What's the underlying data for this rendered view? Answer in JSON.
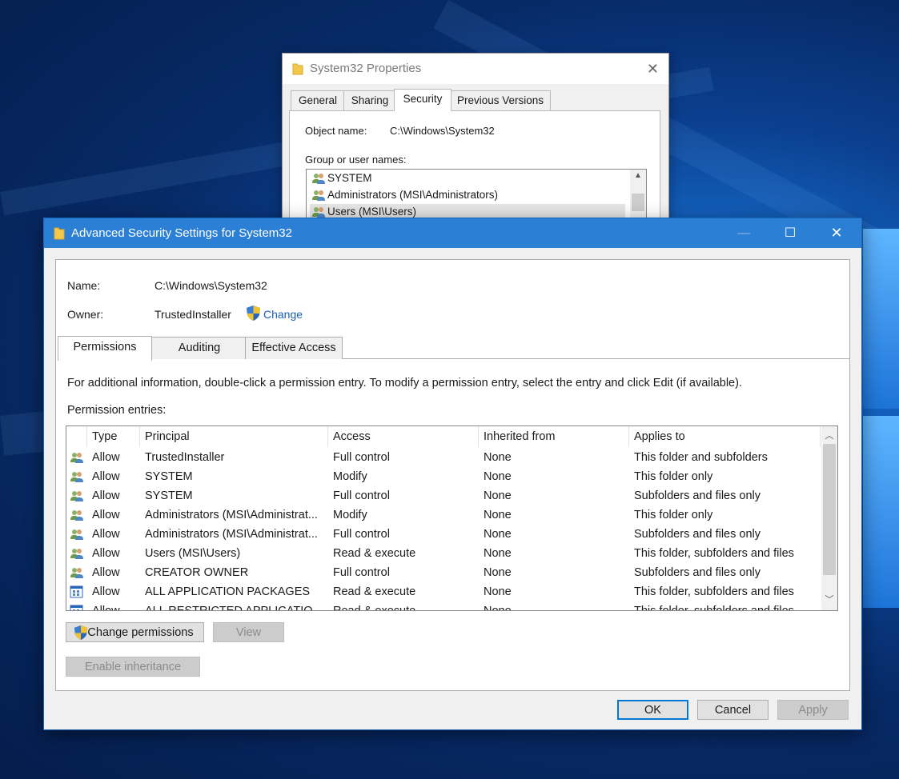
{
  "colors": {
    "accent": "#2b80d6",
    "link": "#1a5fb4"
  },
  "properties_window": {
    "title": "System32 Properties",
    "tabs": [
      {
        "label": "General"
      },
      {
        "label": "Sharing"
      },
      {
        "label": "Security"
      },
      {
        "label": "Previous Versions"
      }
    ],
    "active_tab": "Security",
    "object_name_label": "Object name:",
    "object_name_value": "C:\\Windows\\System32",
    "group_label": "Group or user names:",
    "groups": [
      {
        "name": "SYSTEM"
      },
      {
        "name": "Administrators (MSI\\Administrators)"
      },
      {
        "name": "Users (MSI\\Users)"
      }
    ]
  },
  "dialog": {
    "title": "Advanced Security Settings for System32",
    "name_label": "Name:",
    "name_value": "C:\\Windows\\System32",
    "owner_label": "Owner:",
    "owner_value": "TrustedInstaller",
    "change_link": "Change",
    "tabs": [
      {
        "label": "Permissions"
      },
      {
        "label": "Auditing"
      },
      {
        "label": "Effective Access"
      }
    ],
    "active_tab": "Permissions",
    "info_text": "For additional information, double-click a permission entry. To modify a permission entry, select the entry and click Edit (if available).",
    "entries_label": "Permission entries:",
    "columns": [
      "Type",
      "Principal",
      "Access",
      "Inherited from",
      "Applies to"
    ],
    "rows": [
      {
        "icon": "user-group-icon",
        "type": "Allow",
        "principal": "TrustedInstaller",
        "access": "Full control",
        "inherited": "None",
        "applies": "This folder and subfolders"
      },
      {
        "icon": "user-group-icon",
        "type": "Allow",
        "principal": "SYSTEM",
        "access": "Modify",
        "inherited": "None",
        "applies": "This folder only"
      },
      {
        "icon": "user-group-icon",
        "type": "Allow",
        "principal": "SYSTEM",
        "access": "Full control",
        "inherited": "None",
        "applies": "Subfolders and files only"
      },
      {
        "icon": "user-group-icon",
        "type": "Allow",
        "principal": "Administrators (MSI\\Administrat...",
        "access": "Modify",
        "inherited": "None",
        "applies": "This folder only"
      },
      {
        "icon": "user-group-icon",
        "type": "Allow",
        "principal": "Administrators (MSI\\Administrat...",
        "access": "Full control",
        "inherited": "None",
        "applies": "Subfolders and files only"
      },
      {
        "icon": "user-group-icon",
        "type": "Allow",
        "principal": "Users (MSI\\Users)",
        "access": "Read & execute",
        "inherited": "None",
        "applies": "This folder, subfolders and files"
      },
      {
        "icon": "user-group-icon",
        "type": "Allow",
        "principal": "CREATOR OWNER",
        "access": "Full control",
        "inherited": "None",
        "applies": "Subfolders and files only"
      },
      {
        "icon": "package-icon",
        "type": "Allow",
        "principal": "ALL APPLICATION PACKAGES",
        "access": "Read & execute",
        "inherited": "None",
        "applies": "This folder, subfolders and files"
      },
      {
        "icon": "package-icon",
        "type": "Allow",
        "principal": "ALL RESTRICTED APPLICATION...",
        "access": "Read & execute",
        "inherited": "None",
        "applies": "This folder, subfolders and files"
      }
    ],
    "buttons": {
      "change_permissions": "Change permissions",
      "view": "View",
      "enable_inheritance": "Enable inheritance",
      "ok": "OK",
      "cancel": "Cancel",
      "apply": "Apply"
    }
  }
}
